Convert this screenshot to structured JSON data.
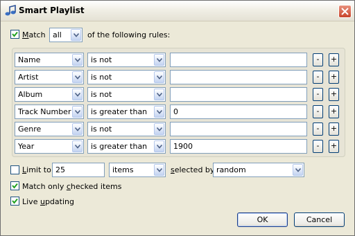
{
  "window": {
    "title": "Smart Playlist"
  },
  "match": {
    "checked": true,
    "label_pre": "",
    "label_key": "M",
    "label_post": "atch",
    "mode": "all",
    "suffix": "of the following rules:"
  },
  "rules": [
    {
      "field": "Name",
      "operator": "is not",
      "value": ""
    },
    {
      "field": "Artist",
      "operator": "is not",
      "value": ""
    },
    {
      "field": "Album",
      "operator": "is not",
      "value": ""
    },
    {
      "field": "Track Number",
      "operator": "is greater than",
      "value": "0"
    },
    {
      "field": "Genre",
      "operator": "is not",
      "value": ""
    },
    {
      "field": "Year",
      "operator": "is greater than",
      "value": "1900"
    }
  ],
  "rule_buttons": {
    "remove": "-",
    "add": "+"
  },
  "limit": {
    "checked": false,
    "label_pre": "",
    "label_key": "L",
    "label_post": "imit to",
    "count": "25",
    "unit": "items",
    "selected_by_pre": "",
    "selected_by_key": "s",
    "selected_by_post": "elected by",
    "method": "random"
  },
  "checked_only": {
    "checked": true,
    "label_pre": "Match only ",
    "label_key": "c",
    "label_post": "hecked items"
  },
  "live_updating": {
    "checked": true,
    "label_pre": "Live ",
    "label_key": "u",
    "label_post": "pdating"
  },
  "buttons": {
    "ok": "OK",
    "cancel": "Cancel"
  },
  "colors": {
    "check": "#21a121",
    "title_bg": "#f1efe6",
    "dialog_bg": "#ece9d8"
  }
}
